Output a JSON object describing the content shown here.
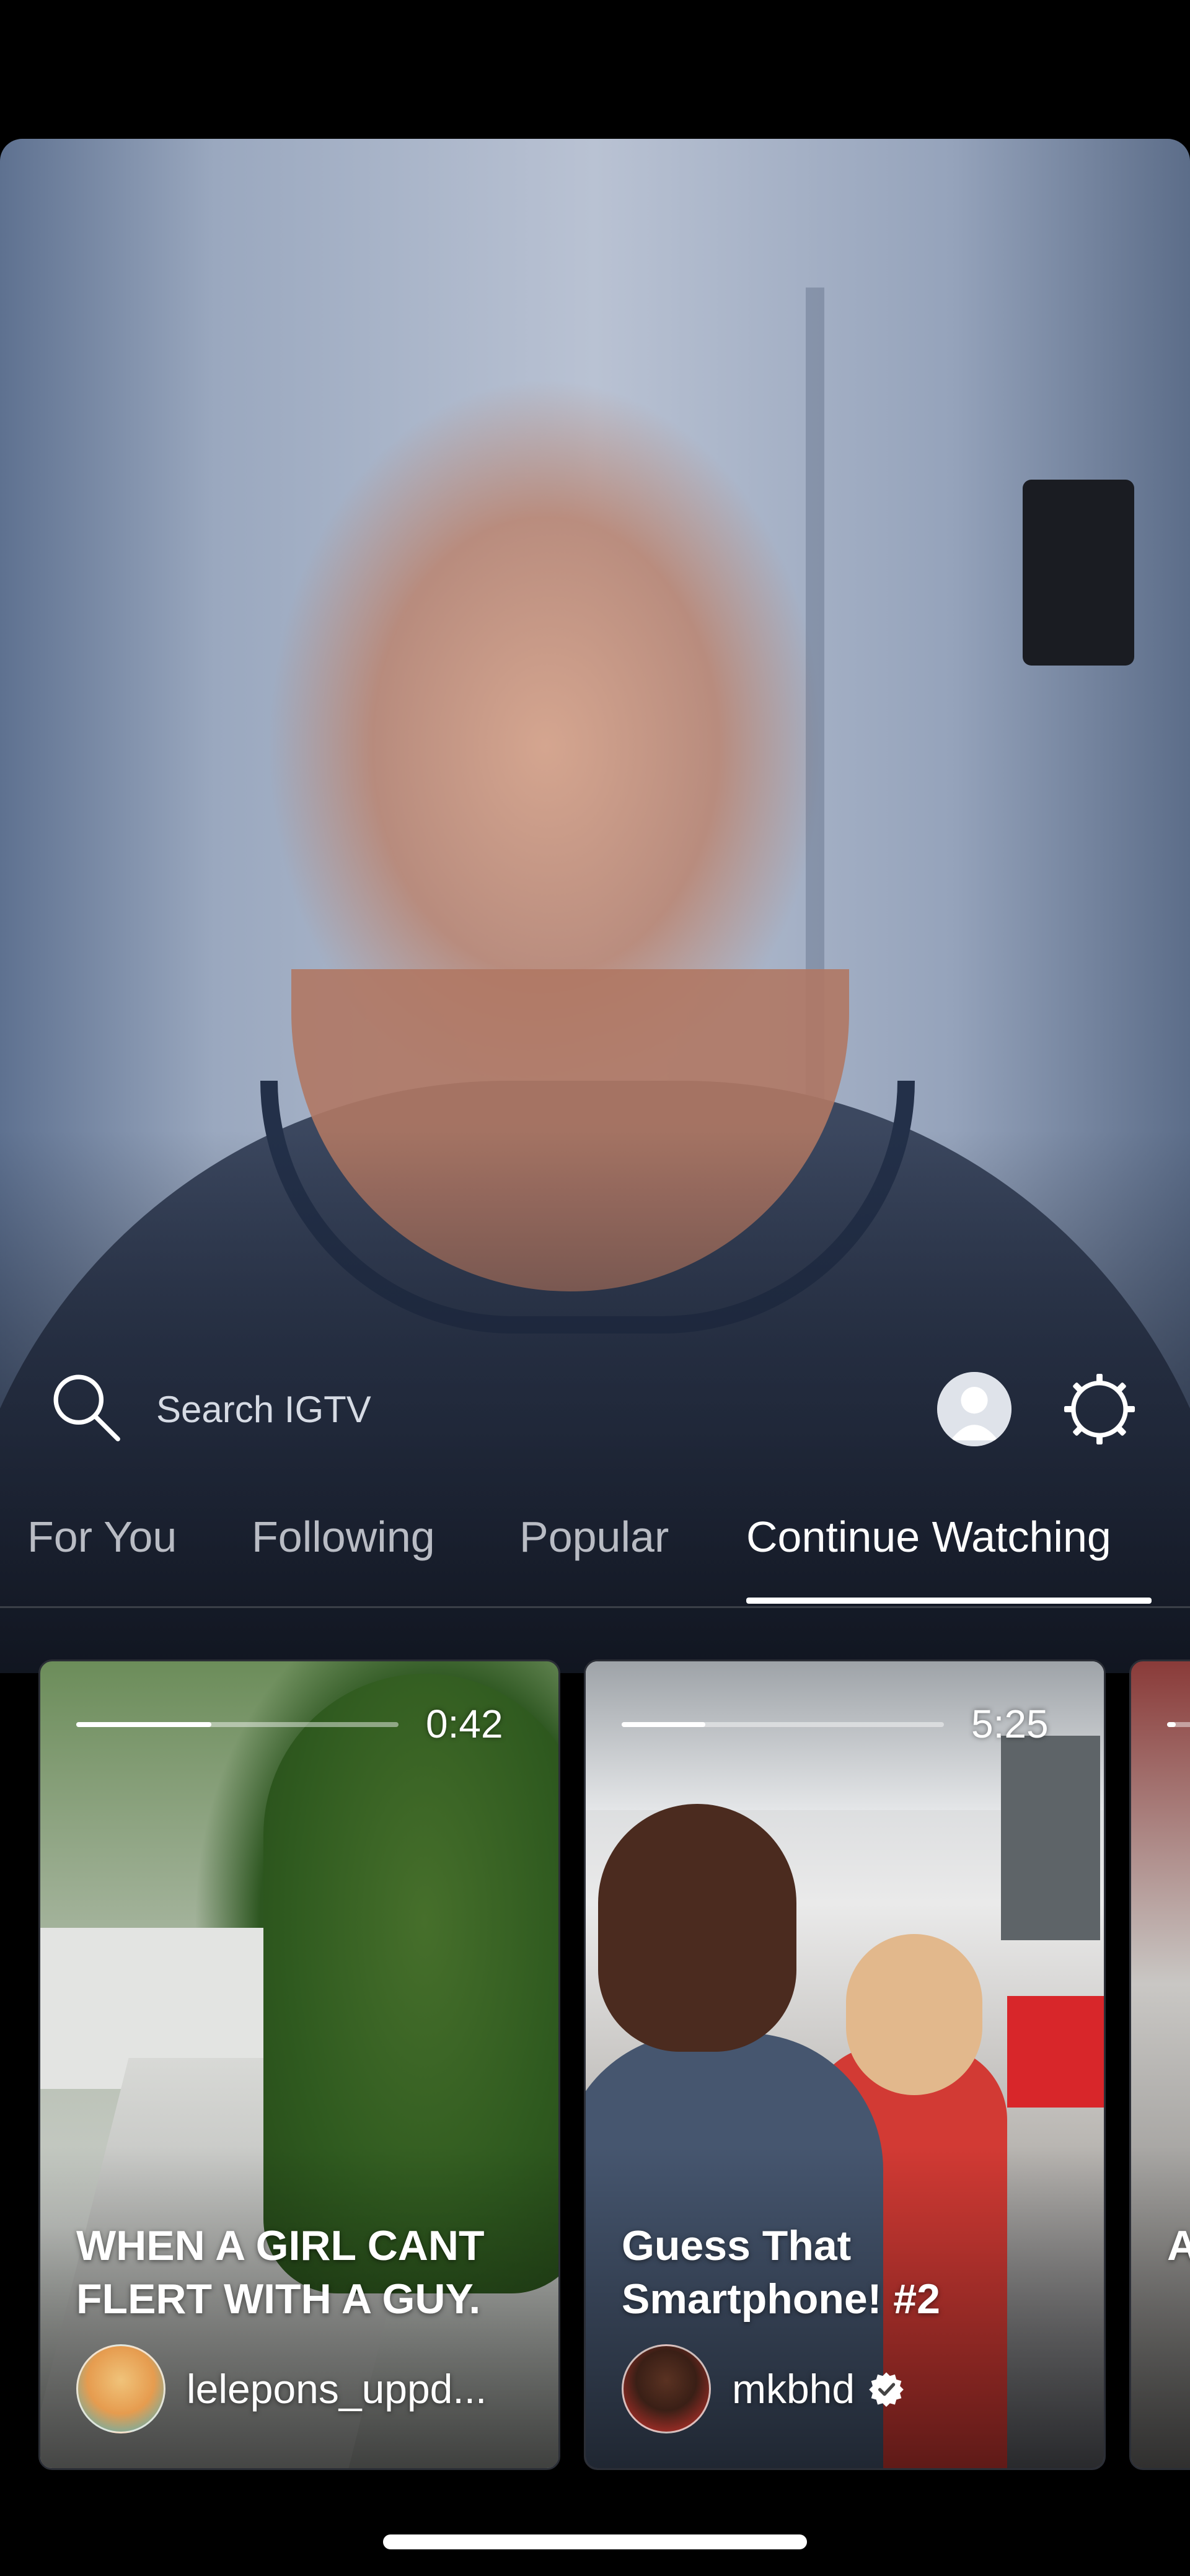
{
  "search": {
    "placeholder": "Search IGTV"
  },
  "tabs": [
    {
      "label": "For You",
      "active": false
    },
    {
      "label": "Following",
      "active": false
    },
    {
      "label": "Popular",
      "active": false
    },
    {
      "label": "Continue Watching",
      "active": true
    }
  ],
  "cards": [
    {
      "title": "WHEN A GIRL CANT FLERT WITH A GUY.",
      "username": "lelepons_uppd...",
      "duration": "0:42",
      "progress": 0.42,
      "verified": false
    },
    {
      "title": "Guess That Smartphone! #2",
      "username": "mkbhd",
      "duration": "5:25",
      "progress": 0.26,
      "verified": true
    },
    {
      "title": "A D",
      "username": "",
      "duration": "",
      "progress": 0.1,
      "verified": false
    }
  ],
  "colors": {
    "background": "#000000",
    "active_tab": "#ffffff",
    "inactive_tab": "#b9bcc4",
    "accent": "#ffffff"
  },
  "icons": [
    "search-icon",
    "profile-icon",
    "settings-gear-icon",
    "verified-badge-icon"
  ]
}
